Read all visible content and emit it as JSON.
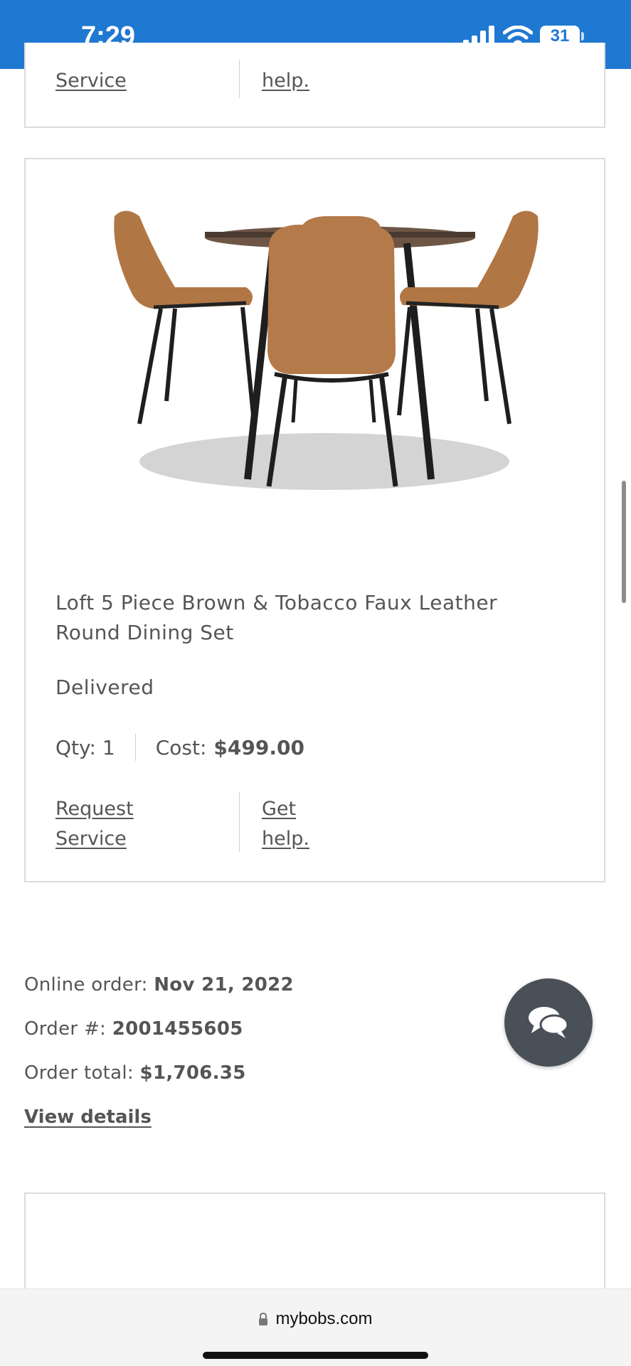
{
  "status_bar": {
    "time": "7:29",
    "battery": "31"
  },
  "top_card": {
    "left_link": "Service",
    "right_link": "help."
  },
  "product": {
    "title_line1": "Loft 5 Piece Brown & Tobacco Faux Leather",
    "title_line2": "Round Dining Set",
    "status": "Delivered",
    "qty_label": "Qty: 1",
    "cost_label": "Cost:",
    "cost_value": "$499.00",
    "request_link_line1": "Request",
    "request_link_line2": "Service",
    "help_link_line1": "Get",
    "help_link_line2": "help."
  },
  "order": {
    "online_label": "Online order:",
    "online_date": "Nov 21, 2022",
    "number_label": "Order #:",
    "number_value": "2001455605",
    "total_label": "Order total:",
    "total_value": "$1,706.35",
    "view_details": "View details"
  },
  "browser": {
    "url": "mybobs.com"
  },
  "colors": {
    "status_bar": "#1f78d1",
    "chat_button": "#4a5058",
    "text": "#555555"
  }
}
